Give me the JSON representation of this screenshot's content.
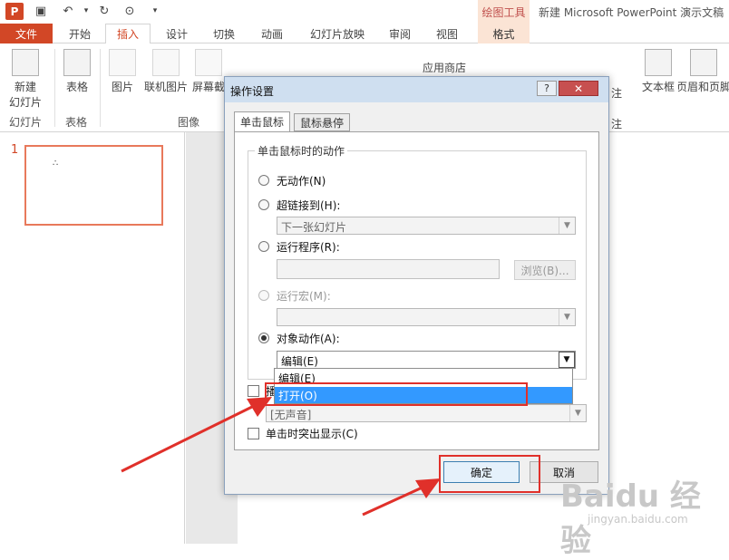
{
  "app": {
    "logo_text": "P",
    "context_tool_title": "绘图工具",
    "window_title": "新建 Microsoft PowerPoint 演示文稿"
  },
  "tabs": {
    "file": "文件",
    "home": "开始",
    "insert": "插入",
    "design": "设计",
    "transitions": "切换",
    "animations": "动画",
    "slideshow": "幻灯片放映",
    "review": "审阅",
    "view": "视图",
    "format": "格式"
  },
  "ribbon": {
    "new_slide_line1": "新建",
    "new_slide_line2": "幻灯片",
    "table": "表格",
    "pictures": "图片",
    "online_pictures": "联机图片",
    "screenshot": "屏幕截",
    "app_store": "应用商店",
    "partial_right": "注",
    "partial_right2": "注",
    "textbox": "文本框",
    "header_footer": "页眉和页脚",
    "group_slides": "幻灯片",
    "group_tables": "表格",
    "group_images": "图像"
  },
  "slides_pane": {
    "slide_number": "1",
    "thumb_mark": "∴"
  },
  "dialog": {
    "title": "操作设置",
    "help": "?",
    "close": "✕",
    "tab_click": "单击鼠标",
    "tab_hover": "鼠标悬停",
    "group_label": "单击鼠标时的动作",
    "opt_none": "无动作(N)",
    "opt_hyperlink": "超链接到(H):",
    "hyperlink_value": "下一张幻灯片",
    "opt_run_program": "运行程序(R):",
    "browse": "浏览(B)...",
    "opt_run_macro": "运行宏(M):",
    "opt_object_action": "对象动作(A):",
    "object_action_value": "编辑(E)",
    "play_sound_partial": "播",
    "sound_value": "[无声音]",
    "highlight_click": "单击时突出显示(C)",
    "ok": "确定",
    "cancel": "取消"
  },
  "dropdown": {
    "items": [
      "编辑(E)",
      "打开(O)"
    ]
  },
  "watermark": {
    "text": "Baidu 经验",
    "sub": "jingyan.baidu.com"
  }
}
